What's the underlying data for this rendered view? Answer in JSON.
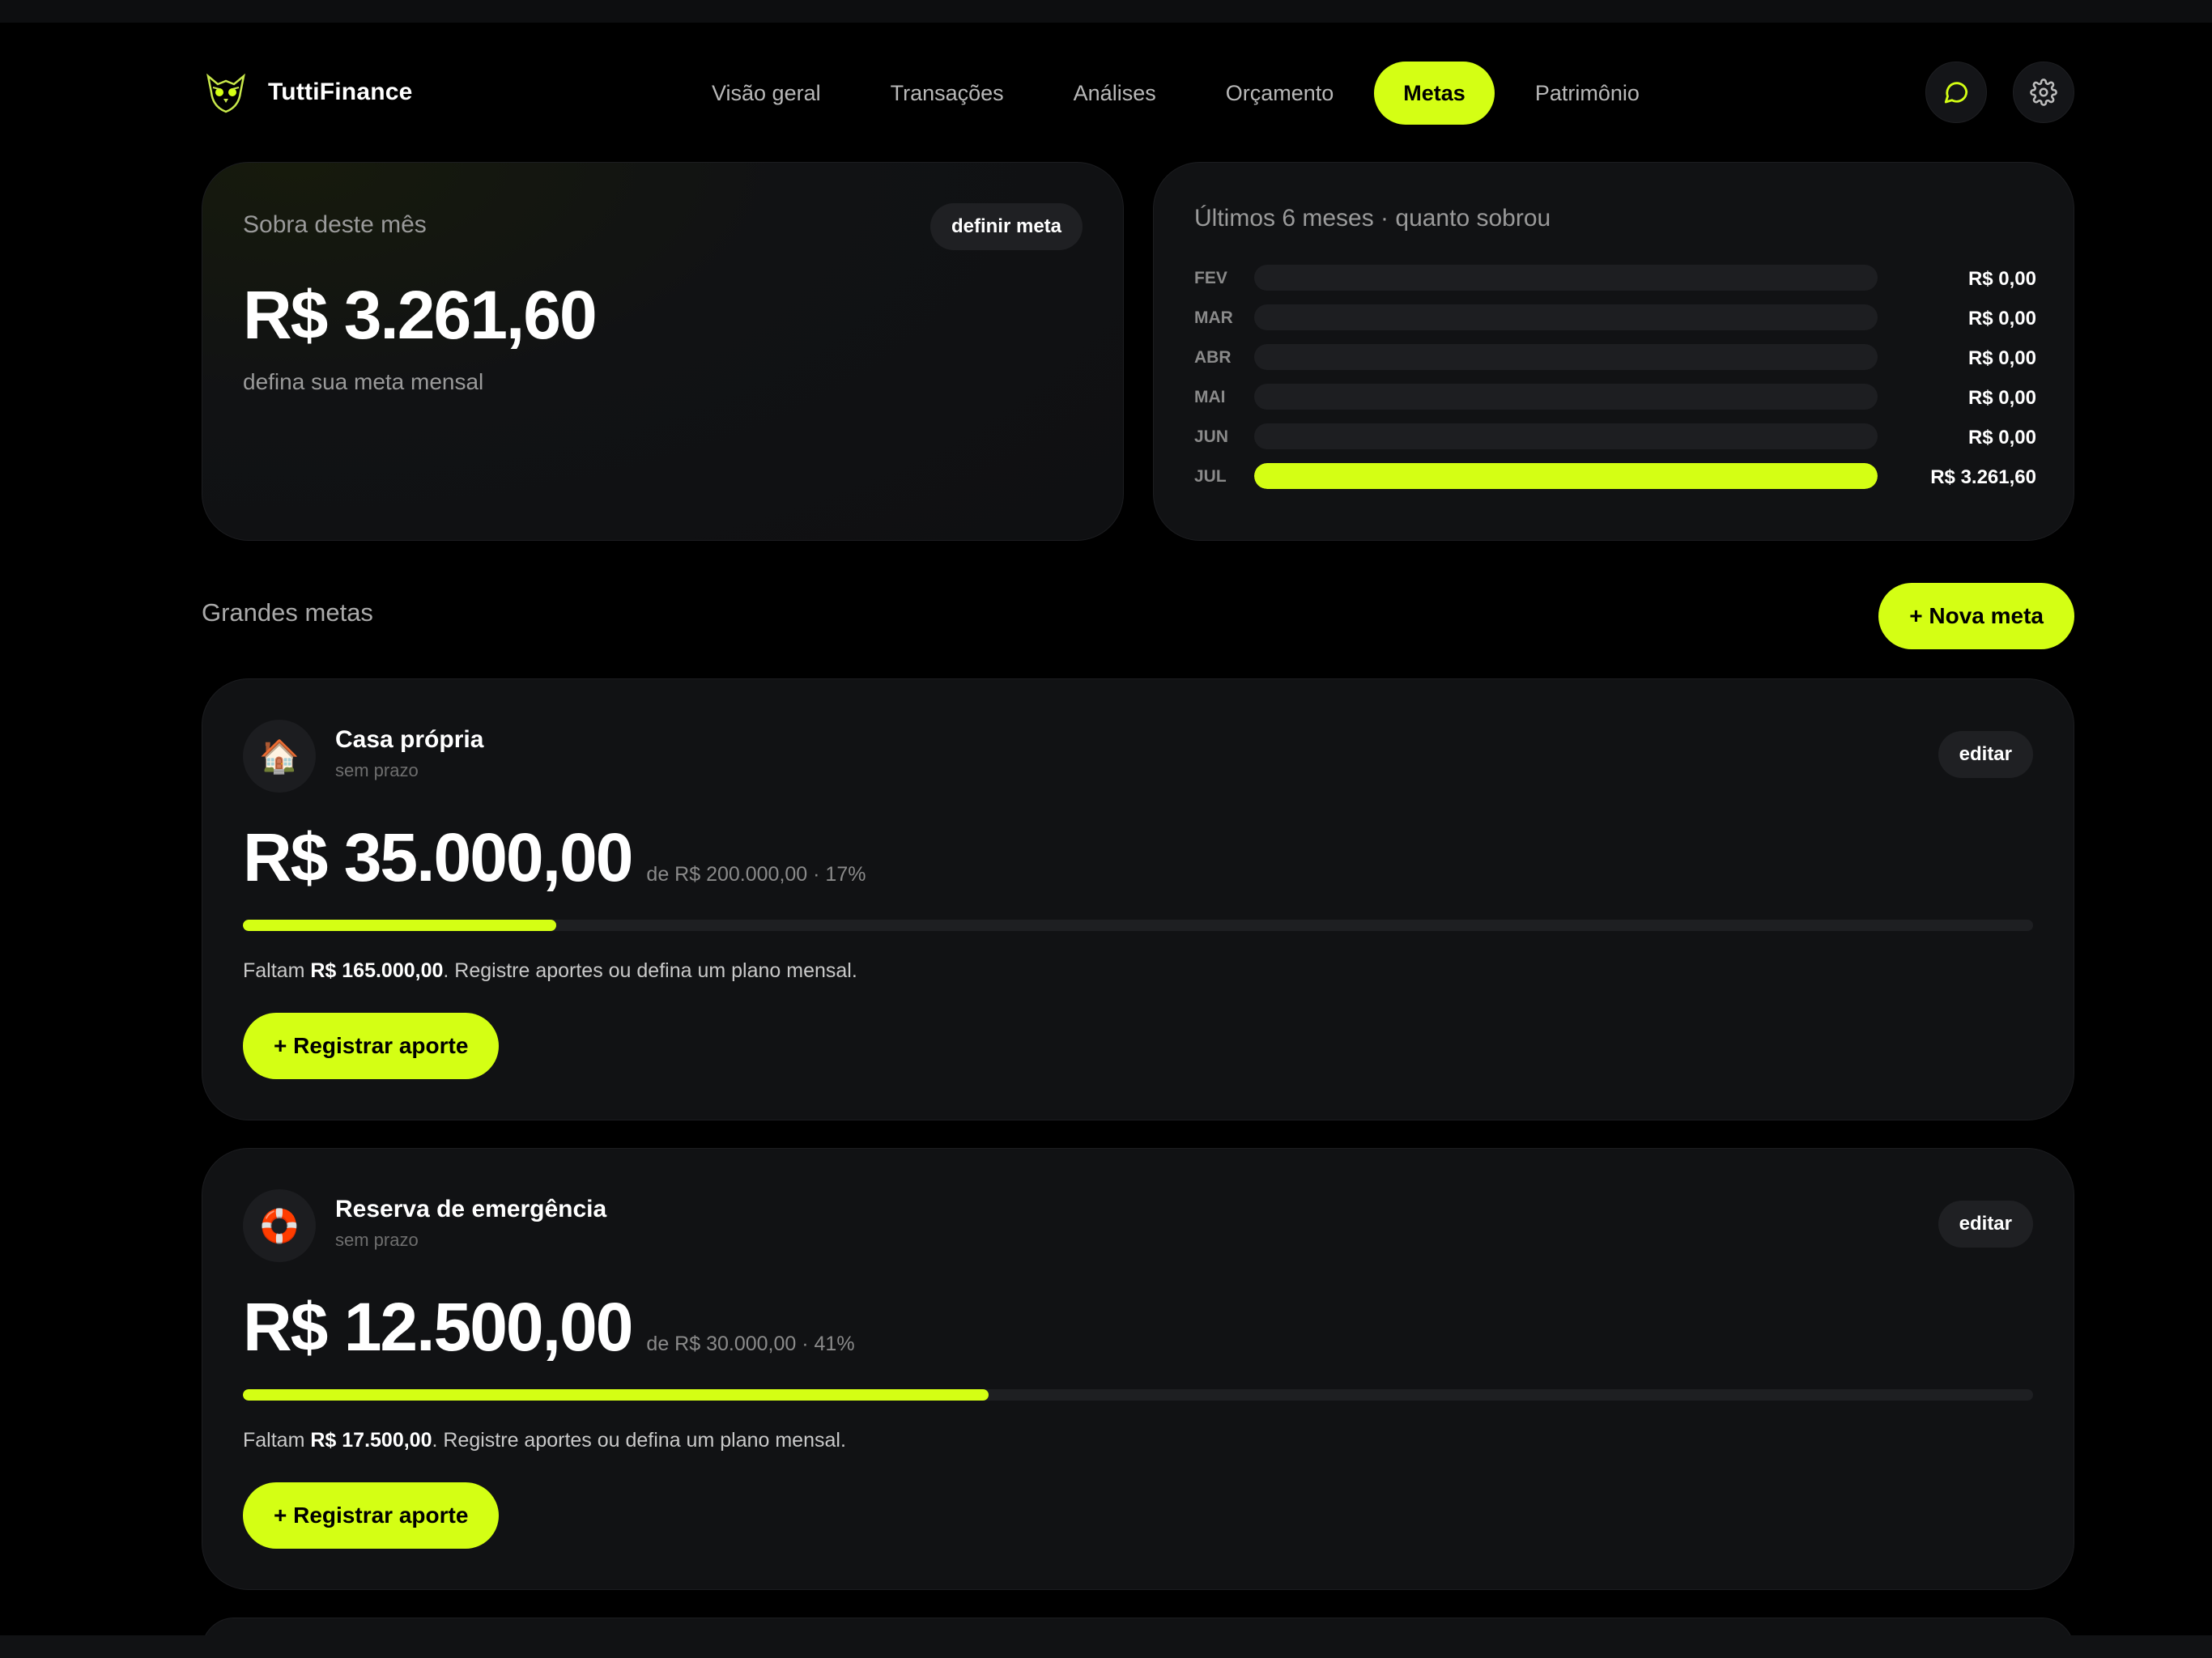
{
  "app": {
    "name": "TuttiFinance"
  },
  "nav": {
    "items": [
      {
        "label": "Visão geral",
        "active": false
      },
      {
        "label": "Transações",
        "active": false
      },
      {
        "label": "Análises",
        "active": false
      },
      {
        "label": "Orçamento",
        "active": false
      },
      {
        "label": "Metas",
        "active": true
      },
      {
        "label": "Patrimônio",
        "active": false
      }
    ],
    "actions": [
      "chat-icon",
      "gear-icon"
    ]
  },
  "month_card": {
    "label": "Sobra deste mês",
    "button": "definir meta",
    "value": "R$ 3.261,60",
    "hint": "defina sua meta mensal"
  },
  "history_card": {
    "label": "Últimos 6 meses · quanto sobrou",
    "rows": [
      {
        "month": "FEV",
        "value_label": "R$ 0,00",
        "value": 0
      },
      {
        "month": "MAR",
        "value_label": "R$ 0,00",
        "value": 0
      },
      {
        "month": "ABR",
        "value_label": "R$ 0,00",
        "value": 0
      },
      {
        "month": "MAI",
        "value_label": "R$ 0,00",
        "value": 0
      },
      {
        "month": "JUN",
        "value_label": "R$ 0,00",
        "value": 0
      },
      {
        "month": "JUL",
        "value_label": "R$ 3.261,60",
        "value": 3261.6
      }
    ]
  },
  "goals_section": {
    "title": "Grandes metas",
    "new_button": "+ Nova meta"
  },
  "goals": [
    {
      "emoji": "🏠",
      "name": "Casa própria",
      "deadline": "sem prazo",
      "edit_label": "editar",
      "amount": "R$ 35.000,00",
      "meta": "de R$ 200.000,00 · 17%",
      "progress": 0.175,
      "remain_prefix": "Faltam ",
      "remain_value": "R$ 165.000,00",
      "remain_suffix": ". Registre aportes ou defina um plano mensal.",
      "button": "+ Registrar aporte"
    },
    {
      "emoji": "🛟",
      "name": "Reserva de emergência",
      "deadline": "sem prazo",
      "edit_label": "editar",
      "amount": "R$ 12.500,00",
      "meta": "de R$ 30.000,00 · 41%",
      "progress": 0.4167,
      "remain_prefix": "Faltam ",
      "remain_value": "R$ 17.500,00",
      "remain_suffix": ". Registre aportes ou defina um plano mensal.",
      "button": "+ Registrar aporte"
    }
  ],
  "colors": {
    "accent": "#d4ff14",
    "card": "#111214",
    "background": "#000000"
  }
}
